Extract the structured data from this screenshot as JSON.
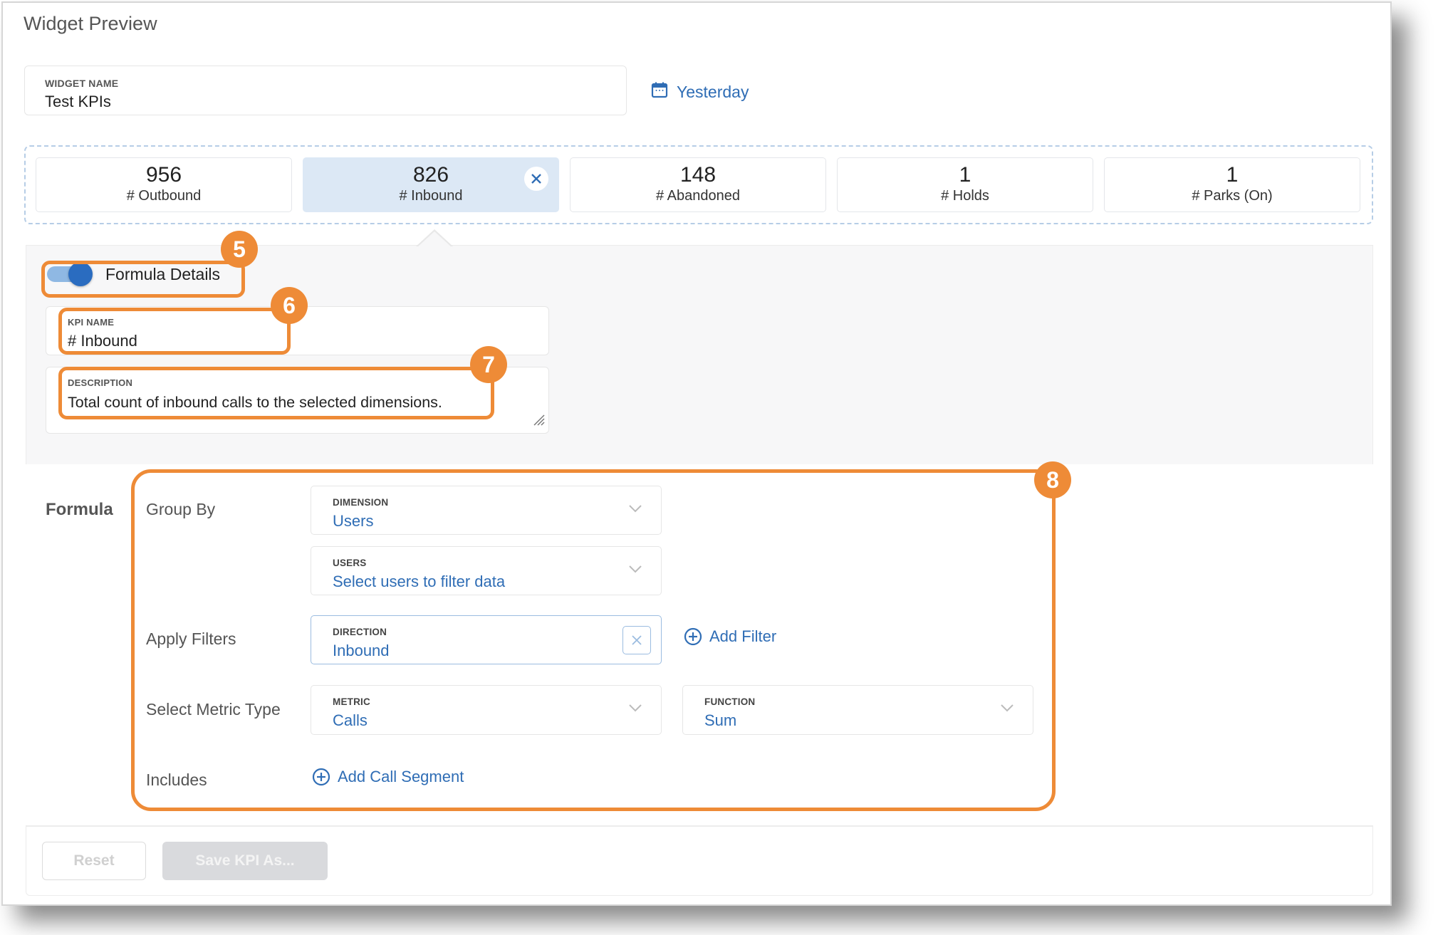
{
  "header": {
    "title": "Widget Preview"
  },
  "widget_name": {
    "label": "WIDGET NAME",
    "value": "Test KPIs"
  },
  "date_range": {
    "label": "Yesterday",
    "icon": "calendar-icon"
  },
  "kpis": [
    {
      "value": "956",
      "label": "# Outbound",
      "selected": false
    },
    {
      "value": "826",
      "label": "# Inbound",
      "selected": true
    },
    {
      "value": "148",
      "label": "# Abandoned",
      "selected": false
    },
    {
      "value": "1",
      "label": "# Holds",
      "selected": false
    },
    {
      "value": "1",
      "label": "# Parks (On)",
      "selected": false
    }
  ],
  "formula_details": {
    "toggle_label": "Formula Details",
    "toggle_on": true,
    "kpi_name": {
      "label": "KPI NAME",
      "value": "# Inbound"
    },
    "description": {
      "label": "DESCRIPTION",
      "value": "Total count of inbound calls to the selected dimensions."
    }
  },
  "formula": {
    "title": "Formula",
    "group_by": {
      "label": "Group By",
      "dimension": {
        "label": "DIMENSION",
        "value": "Users"
      },
      "users": {
        "label": "USERS",
        "value": "Select users to filter data"
      }
    },
    "apply_filters": {
      "label": "Apply Filters",
      "direction": {
        "label": "DIRECTION",
        "value": "Inbound"
      },
      "add_filter": "Add Filter"
    },
    "metric_type": {
      "label": "Select Metric Type",
      "metric": {
        "label": "METRIC",
        "value": "Calls"
      },
      "function": {
        "label": "FUNCTION",
        "value": "Sum"
      }
    },
    "includes": {
      "label": "Includes",
      "add_segment": "Add Call Segment"
    }
  },
  "footer": {
    "reset_label": "Reset",
    "save_label": "Save KPI As..."
  },
  "callouts": {
    "c5": "5",
    "c6": "6",
    "c7": "7",
    "c8": "8"
  },
  "colors": {
    "accent": "#2f6db5",
    "callout": "#ee8b37",
    "selected_card": "#dce8f5",
    "toggle": "#2a6cc0"
  }
}
